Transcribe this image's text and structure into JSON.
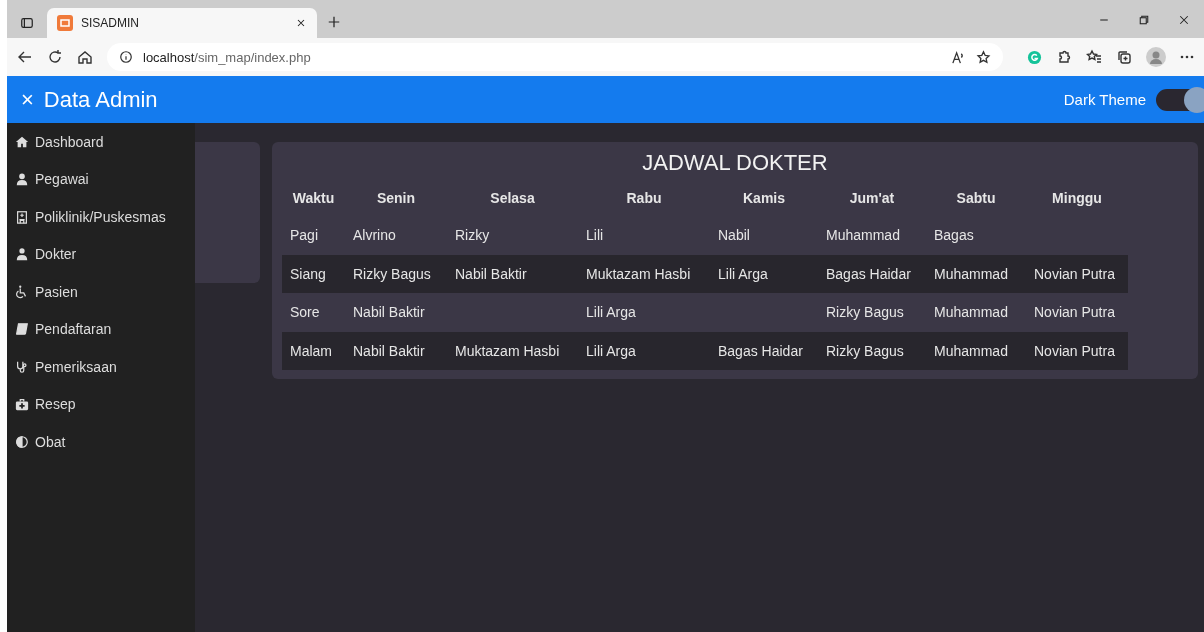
{
  "browser": {
    "tab_title": "SISADMIN",
    "address_host": "localhost",
    "address_path": "/sim_map/index.php"
  },
  "header": {
    "close_symbol": "×",
    "title": "Data Admin",
    "theme_label": "Dark Theme",
    "dark_theme_on": true
  },
  "sidebar": {
    "items": [
      {
        "label": "Dashboard",
        "kind": "home"
      },
      {
        "label": "Pegawai",
        "kind": "user"
      },
      {
        "label": "Poliklinik/Puskesmas",
        "kind": "hospital"
      },
      {
        "label": "Dokter",
        "kind": "doctor"
      },
      {
        "label": "Pasien",
        "kind": "wheelchair"
      },
      {
        "label": "Pendaftaran",
        "kind": "book"
      },
      {
        "label": "Pemeriksaan",
        "kind": "stethoscope"
      },
      {
        "label": "Resep",
        "kind": "medkit"
      },
      {
        "label": "Obat",
        "kind": "contrast"
      }
    ]
  },
  "schedule": {
    "title": "JADWAL DOKTER",
    "columns": [
      "Waktu",
      "Senin",
      "Selasa",
      "Rabu",
      "Kamis",
      "Jum'at",
      "Sabtu",
      "Minggu"
    ],
    "rows": [
      [
        "Pagi",
        "Alvrino",
        "Rizky",
        "Lili",
        "Nabil",
        "Muhammad",
        "Bagas",
        null
      ],
      [
        "Siang",
        "Rizky Bagus",
        "Nabil Baktir",
        "Muktazam Hasbi",
        "Lili Arga",
        "Bagas Haidar",
        "Muhammad",
        "Novian Putra"
      ],
      [
        "Sore",
        "Nabil Baktir",
        null,
        "Lili Arga",
        null,
        "Rizky Bagus",
        "Muhammad",
        "Novian Putra"
      ],
      [
        "Malam",
        "Nabil Baktir",
        "Muktazam Hasbi",
        "Lili Arga",
        "Bagas Haidar",
        "Rizky Bagus",
        "Muhammad",
        "Novian Putra"
      ]
    ]
  }
}
